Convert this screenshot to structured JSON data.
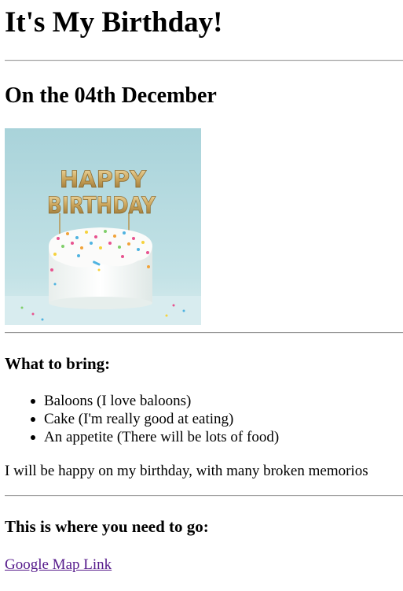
{
  "title": "It's My Birthday!",
  "date_heading": "On the 04th December",
  "image": {
    "alt": "",
    "topper_text": [
      "HAPPY",
      "BIRTHDAY"
    ]
  },
  "bring": {
    "heading": "What to bring:",
    "items": [
      "Baloons (I love baloons)",
      "Cake (I'm really good at eating)",
      "An appetite (There will be lots of food)"
    ]
  },
  "note": "I will be happy on my birthday, with many broken memorios",
  "location": {
    "heading": "This is where you need to go:",
    "link_label": "Google Map Link"
  },
  "colors": {
    "link": "#551a8b",
    "rule": "#9a9a9a",
    "photo_background": "#b9dde3"
  }
}
